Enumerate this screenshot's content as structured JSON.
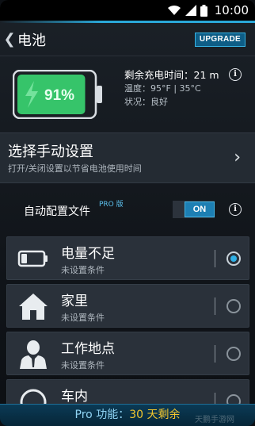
{
  "status_bar": {
    "time": "10:00",
    "icons": [
      "wifi-icon",
      "signal-icon",
      "battery-status-icon"
    ]
  },
  "action_bar": {
    "back_icon": "chevron-left-icon",
    "title": "电池",
    "upgrade_label": "UPGRADE"
  },
  "battery": {
    "percent_label": "91%",
    "charge_level": 0.91,
    "remaining_label": "剩余充电时间：",
    "remaining_value": "21 m",
    "temp_label": "温度：",
    "temp_value": "95°F | 35°C",
    "status_label": "状况：",
    "status_value": "良好"
  },
  "manual": {
    "title": "选择手动设置",
    "subtitle": "打开/关闭设置以节省电池使用时间"
  },
  "profile": {
    "label": "自动配置文件",
    "pro_tag": "PRO 版",
    "toggle_label": "ON"
  },
  "items": [
    {
      "title": "电量不足",
      "subtitle": "未设置条件",
      "icon": "low-battery-icon",
      "checked": true
    },
    {
      "title": "家里",
      "subtitle": "未设置条件",
      "icon": "home-icon",
      "checked": false
    },
    {
      "title": "工作地点",
      "subtitle": "未设置条件",
      "icon": "person-icon",
      "checked": false
    },
    {
      "title": "车内",
      "subtitle": "",
      "icon": "steering-wheel-icon",
      "checked": false
    }
  ],
  "footer": {
    "prefix": "Pro 功能：",
    "highlight": "30 天剩余"
  },
  "watermark": "天鹏手游网",
  "colors": {
    "accent": "#2aa8d8",
    "battery_green": "#36c46a",
    "footer_highlight": "#f2c62e"
  }
}
